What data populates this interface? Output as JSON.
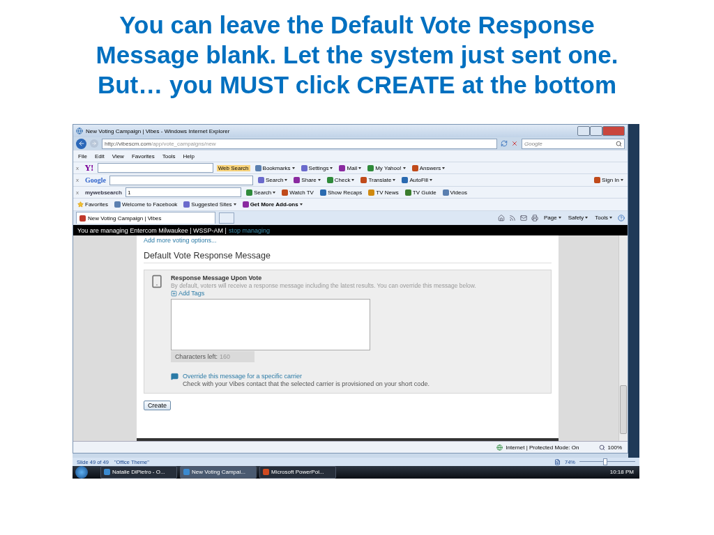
{
  "slide": {
    "title_lines": [
      "You can leave the Default Vote Response",
      "Message blank. Let the system just sent one.",
      "But… you MUST click CREATE at the bottom"
    ]
  },
  "browser": {
    "title": "New Voting Campaign | Vibes - Windows Internet Explorer",
    "url_host": "http://vibescm.com",
    "url_path": "/app/vote_campaigns/new",
    "search_placeholder": "Google",
    "menu": [
      "File",
      "Edit",
      "View",
      "Favorites",
      "Tools",
      "Help"
    ],
    "toolbars": [
      {
        "close": "x",
        "brand": "Y!",
        "kind": "yahoo",
        "items": [
          {
            "label": "Web Search",
            "icon": false,
            "menu": false,
            "highlight": true
          },
          {
            "label": "Bookmarks",
            "icon": true,
            "menu": true,
            "highlight": false
          },
          {
            "label": "Settings",
            "icon": true,
            "menu": true,
            "highlight": false
          },
          {
            "label": "Mail",
            "icon": true,
            "menu": true,
            "highlight": false
          },
          {
            "label": "My Yahoo!",
            "icon": true,
            "menu": true,
            "highlight": false
          },
          {
            "label": "Answers",
            "icon": true,
            "menu": true,
            "highlight": false
          }
        ]
      },
      {
        "close": "x",
        "brand": "Google",
        "kind": "google",
        "items": [
          {
            "label": "Search",
            "icon": true,
            "menu": true,
            "highlight": false
          },
          {
            "label": "Share",
            "icon": true,
            "menu": true,
            "highlight": false
          },
          {
            "label": "Check",
            "icon": true,
            "menu": true,
            "highlight": false
          },
          {
            "label": "Translate",
            "icon": true,
            "menu": true,
            "highlight": false
          },
          {
            "label": "AutoFill",
            "icon": true,
            "menu": true,
            "highlight": false
          }
        ],
        "right": [
          {
            "label": "Sign In",
            "icon": true,
            "menu": true,
            "highlight": false
          }
        ]
      },
      {
        "close": "x",
        "brand": "my**web**search",
        "kind": "mywebsearch",
        "field": "1",
        "items": [
          {
            "label": "Search",
            "icon": true,
            "menu": true,
            "highlight": false
          },
          {
            "label": "Watch TV",
            "icon": true,
            "menu": false,
            "highlight": false
          },
          {
            "label": "Show Recaps",
            "icon": true,
            "menu": false,
            "highlight": false
          },
          {
            "label": "TV News",
            "icon": true,
            "menu": false,
            "highlight": false
          },
          {
            "label": "TV Guide",
            "icon": true,
            "menu": false,
            "highlight": false
          },
          {
            "label": "Videos",
            "icon": true,
            "menu": false,
            "highlight": false
          }
        ]
      }
    ],
    "favorites": [
      {
        "label": "Favorites",
        "bold": false,
        "menu": false
      },
      {
        "label": "Welcome to Facebook",
        "bold": false,
        "menu": false
      },
      {
        "label": "Suggested Sites",
        "bold": false,
        "menu": true
      },
      {
        "label": "Get More Add-ons",
        "bold": true,
        "menu": true
      }
    ],
    "tabs": [
      {
        "label": "New Voting Campaign | Vibes",
        "selected": true
      }
    ],
    "commands": [
      "Page",
      "Safety",
      "Tools"
    ],
    "status": "Internet | Protected Mode: On",
    "zoom": "100%"
  },
  "page": {
    "banner": "You are managing Entercom Milwaukee | WSSP-AM |",
    "banner_link": "stop managing",
    "add_more": "Add more voting options...",
    "heading": "Default Vote Response Message",
    "card": {
      "title": "Response Message Upon Vote",
      "description": "By default, voters will receive a response message including the latest results. You can override this message below.",
      "add_tags": "Add Tags",
      "chars_label": "Characters left:",
      "chars_value": "160",
      "override_link": "Override this message for a specific carrier",
      "override_note": "Check with your Vibes contact that the selected carrier is provisioned on your short code."
    },
    "create": "Create"
  },
  "powerpoint": {
    "slide": "Slide 49 of 49",
    "theme": "\"Office Theme\"",
    "zoom": "74%",
    "zoom_slider": {
      "level": 0.45
    }
  },
  "taskbar": {
    "tasks": [
      {
        "label": "Natalie DiPietro - O...",
        "selected": false
      },
      {
        "label": "New Voting Campai...",
        "selected": true
      },
      {
        "label": "Microsoft PowerPoi...",
        "selected": false
      }
    ],
    "time": "10:18 PM"
  }
}
